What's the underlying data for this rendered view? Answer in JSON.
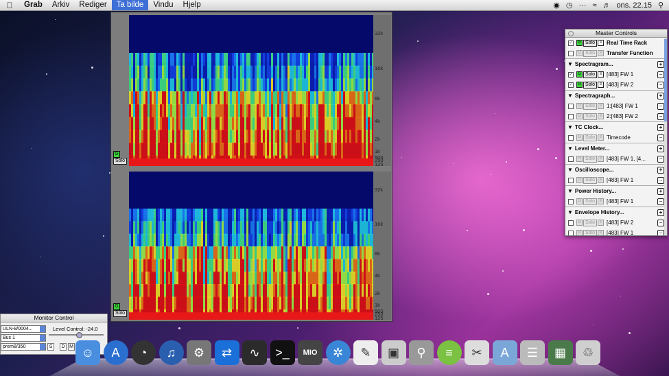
{
  "menubar": {
    "apple_icon": "apple-icon",
    "items": [
      "Grab",
      "Arkiv",
      "Rediger",
      "Ta bilde",
      "Vindu",
      "Hjelp"
    ],
    "active_item": "Ta bilde",
    "clock": "ons. 22.15",
    "status_icons": [
      "record-icon",
      "time-machine-icon",
      "dots-icon",
      "wifi-icon",
      "volume-icon",
      "spotlight-icon"
    ]
  },
  "spectrogram": {
    "top_ticks": [
      "32k",
      "16k",
      "8k",
      "4k",
      "2k",
      "1k",
      "500",
      "250",
      "125"
    ],
    "bottom_ticks": [
      "32k",
      "16k",
      "8k",
      "4k",
      "2k",
      "1k",
      "500",
      "250",
      "125"
    ],
    "solo_label": "Solo"
  },
  "master_controls": {
    "title": "Master Controls",
    "rows": [
      {
        "type": "item",
        "checked": true,
        "g": true,
        "solo": true,
        "label": "Real Time Rack",
        "bold": true
      },
      {
        "type": "item",
        "checked": false,
        "g": false,
        "solo": false,
        "label": "Transfer Function",
        "bold": true
      },
      {
        "type": "section",
        "label": "Spectragram..."
      },
      {
        "type": "item",
        "checked": true,
        "g": true,
        "solo": true,
        "label": "[483] FW 1"
      },
      {
        "type": "item",
        "checked": true,
        "g": true,
        "solo": true,
        "label": "[483] FW 2"
      },
      {
        "type": "section",
        "label": "Spectragraph..."
      },
      {
        "type": "item",
        "checked": false,
        "g": false,
        "solo": false,
        "label": "1:[483] FW 1"
      },
      {
        "type": "item",
        "checked": false,
        "g": false,
        "solo": false,
        "label": "2:[483] FW 2"
      },
      {
        "type": "section",
        "label": "TC Clock..."
      },
      {
        "type": "item",
        "checked": false,
        "g": false,
        "solo": false,
        "label": "Timecode"
      },
      {
        "type": "section",
        "label": "Level Meter..."
      },
      {
        "type": "item",
        "checked": false,
        "g": false,
        "solo": false,
        "label": "[483] FW 1, [4..."
      },
      {
        "type": "section",
        "label": "Oscilloscope..."
      },
      {
        "type": "item",
        "checked": false,
        "g": false,
        "solo": false,
        "label": "[483] FW 1"
      },
      {
        "type": "section",
        "label": "Power History..."
      },
      {
        "type": "item",
        "checked": false,
        "g": false,
        "solo": false,
        "label": "[483] FW 1"
      },
      {
        "type": "section",
        "label": "Envelope History..."
      },
      {
        "type": "item",
        "checked": false,
        "g": false,
        "solo": false,
        "label": "[483] FW 2"
      },
      {
        "type": "item",
        "checked": false,
        "g": false,
        "solo": false,
        "label": "[483] FW 1"
      }
    ]
  },
  "monitor_control": {
    "title": "Monitor Control",
    "device": "ULN-8/0004...",
    "bus": "Bus 1",
    "preset": "prem8/350",
    "level_label": "Level Control:",
    "level_value": "-24.0",
    "level_fraction": 0.55,
    "buttons": [
      "S",
      "D",
      "M",
      "L"
    ]
  },
  "dock": {
    "items": [
      {
        "name": "finder-icon",
        "color": "#4a8ee0"
      },
      {
        "name": "app-store-icon",
        "color": "#2a6fd0"
      },
      {
        "name": "dashboard-icon",
        "color": "#333"
      },
      {
        "name": "itunes-icon",
        "color": "#2a5fb0"
      },
      {
        "name": "system-preferences-icon",
        "color": "#777"
      },
      {
        "name": "teamviewer-icon",
        "color": "#1a6fd8"
      },
      {
        "name": "activity-monitor-icon",
        "color": "#2b2b2b"
      },
      {
        "name": "terminal-icon",
        "color": "#111"
      },
      {
        "name": "mio-icon",
        "color": "#444"
      },
      {
        "name": "safari-icon",
        "color": "#3a86d6"
      },
      {
        "name": "textedit-icon",
        "color": "#eee"
      },
      {
        "name": "preview-icon",
        "color": "#ccc"
      },
      {
        "name": "magnifier-icon",
        "color": "#999"
      },
      {
        "name": "spotify-icon",
        "color": "#7bc142"
      },
      {
        "name": "grab-icon",
        "color": "#ddd"
      },
      {
        "name": "applications-folder-icon",
        "color": "#7aa7d8"
      },
      {
        "name": "documents-stack-icon",
        "color": "#bbb"
      },
      {
        "name": "downloads-stack-icon",
        "color": "#4a7a4a"
      },
      {
        "name": "trash-icon",
        "color": "#cfcfcf"
      }
    ],
    "mio_label": "MIO"
  }
}
